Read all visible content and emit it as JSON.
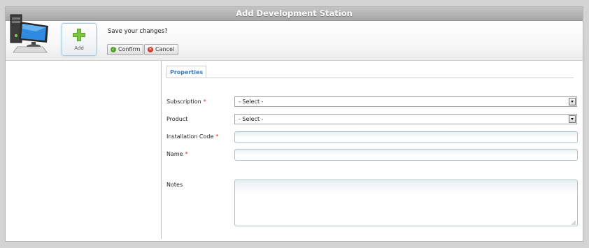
{
  "window": {
    "title": "Add Development Station"
  },
  "toolbar": {
    "add_label": "Add",
    "prompt": "Save your changes?",
    "confirm_label": "Confirm",
    "cancel_label": "Cancel"
  },
  "tabs": [
    {
      "label": "Properties"
    }
  ],
  "form": {
    "subscription": {
      "label": "Subscription",
      "required": "*",
      "value": "- Select -"
    },
    "product": {
      "label": "Product",
      "value": "- Select -"
    },
    "installation_code": {
      "label": "Installation Code",
      "required": "*",
      "value": ""
    },
    "name": {
      "label": "Name",
      "required": "*",
      "value": ""
    },
    "notes": {
      "label": "Notes",
      "value": ""
    }
  },
  "colors": {
    "titlebar": "#b0b0b0",
    "tab_text": "#3a7dbf",
    "required": "#dd2222",
    "confirm_icon": "#54a32a",
    "cancel_icon": "#d13b28",
    "add_plus": "#5aa02c"
  },
  "icons": [
    "development-station-icon",
    "plus-icon",
    "check-icon",
    "close-icon",
    "dropdown-arrow-icon",
    "resize-grip-icon"
  ]
}
